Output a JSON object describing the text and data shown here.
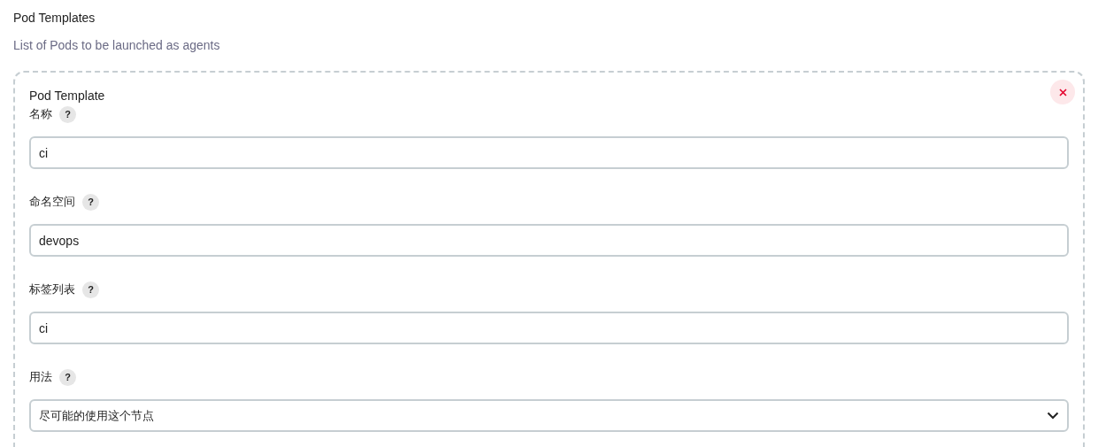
{
  "section": {
    "title": "Pod Templates",
    "description": "List of Pods to be launched as agents"
  },
  "template": {
    "title": "Pod Template",
    "fields": [
      {
        "kind": "text",
        "label": "名称",
        "help": "?",
        "value": "ci"
      },
      {
        "kind": "text",
        "label": "命名空间",
        "help": "?",
        "value": "devops"
      },
      {
        "kind": "text",
        "label": "标签列表",
        "help": "?",
        "value": "ci"
      },
      {
        "kind": "select",
        "label": "用法",
        "help": "?",
        "value": "尽可能的使用这个节点"
      }
    ]
  }
}
